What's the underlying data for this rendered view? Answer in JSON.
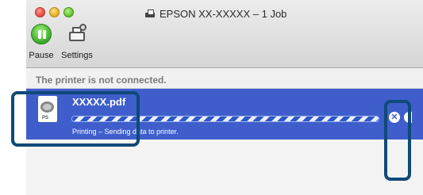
{
  "window": {
    "title": "EPSON XX-XXXXX – 1 Job",
    "title_icon": "printer-icon"
  },
  "toolbar": {
    "pause_label": "Pause",
    "pause_icon": "pause-icon",
    "settings_label": "Settings",
    "settings_icon": "printer-settings-icon"
  },
  "status_message": "The printer is not connected.",
  "job": {
    "name": "XXXXX.pdf",
    "status": "Printing – Sending data to printer.",
    "doc_icon_tag": "PS",
    "cancel_icon": "close-circle-icon",
    "progress": "indeterminate"
  },
  "colors": {
    "selection": "#3f5ecc",
    "callout": "#0f4a78",
    "pause_green": "#3aa82a"
  }
}
